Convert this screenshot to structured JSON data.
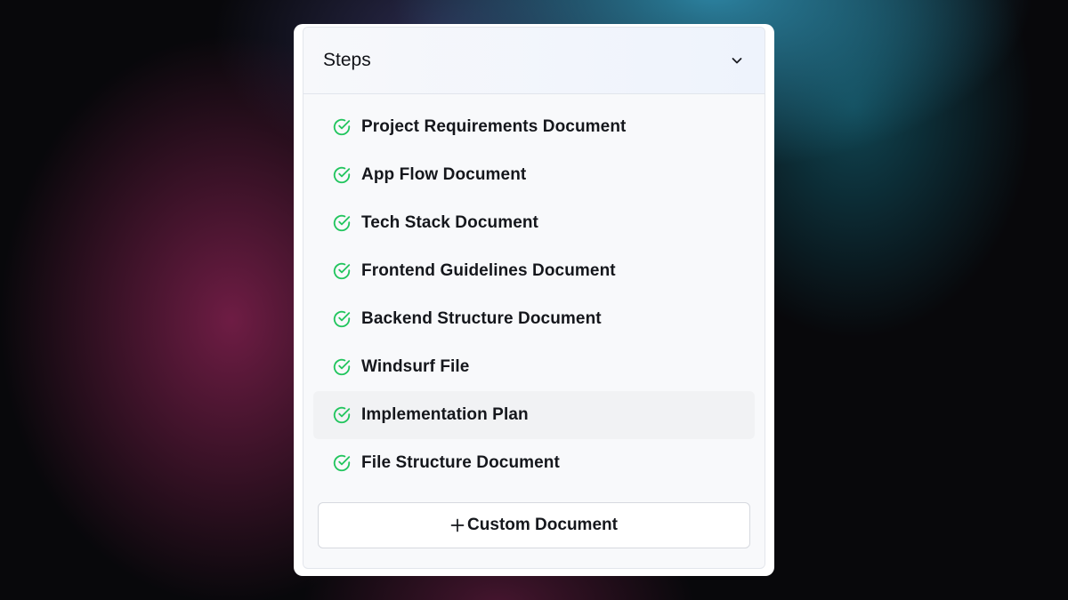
{
  "panel": {
    "title": "Steps",
    "collapse_icon": "chevron-down-icon"
  },
  "steps": [
    {
      "label": "Project Requirements Document",
      "status": "complete",
      "icon": "check-circle-icon"
    },
    {
      "label": "App Flow Document",
      "status": "complete",
      "icon": "check-circle-icon"
    },
    {
      "label": "Tech Stack Document",
      "status": "complete",
      "icon": "check-circle-icon"
    },
    {
      "label": "Frontend Guidelines Document",
      "status": "complete",
      "icon": "check-circle-icon"
    },
    {
      "label": "Backend Structure Document",
      "status": "complete",
      "icon": "check-circle-icon"
    },
    {
      "label": "Windsurf File",
      "status": "complete",
      "icon": "check-circle-icon"
    },
    {
      "label": "Implementation Plan",
      "status": "complete",
      "icon": "check-circle-icon",
      "highlighted": true
    },
    {
      "label": "File Structure Document",
      "status": "complete",
      "icon": "check-circle-icon"
    }
  ],
  "add_button": {
    "label": "Custom Document",
    "icon": "plus-icon"
  },
  "colors": {
    "check": "#22c55e",
    "text": "#15171c",
    "highlight": "#f1f2f4"
  }
}
